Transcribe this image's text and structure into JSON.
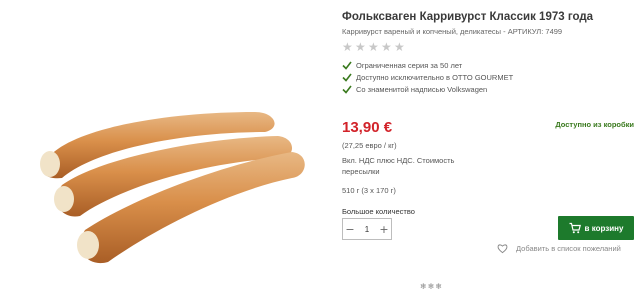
{
  "product": {
    "title": "Фольксваген Карривурст Классик 1973 года",
    "subtitle": "Карривурст вареный и копченый, деликатесы - АРТИКУЛ: 7499",
    "rating_stars": 5,
    "features": [
      "Ограниченная серия за 50 лет",
      "Доступно исключительно в OTTO GOURMET",
      "Со знаменитой надписью Volkswagen"
    ],
    "price": "13,90 €",
    "availability": "Доступно из коробки",
    "unit_price": "(27,25 евро / кг)",
    "vat_note": "Вкл. НДС плюс НДС. Стоимость пересылки",
    "weight": "510 г (3 х 170 г)",
    "bulk_label": "Большое количество",
    "quantity": "1",
    "cart_button": "в корзину",
    "wishlist": "Добавить в список пожеланий",
    "snowflakes": "❄❄❄"
  },
  "colors": {
    "price": "#d2232a",
    "availability": "#3a7a1e",
    "cart_button": "#1d7a2c",
    "checkmark": "#3a7a1e",
    "star_empty": "#c8c8c8"
  },
  "icons": {
    "feature": "check-icon",
    "rating": "star-icon",
    "cart": "cart-icon",
    "wishlist": "heart-icon",
    "decrease": "minus-icon",
    "increase": "plus-icon"
  }
}
